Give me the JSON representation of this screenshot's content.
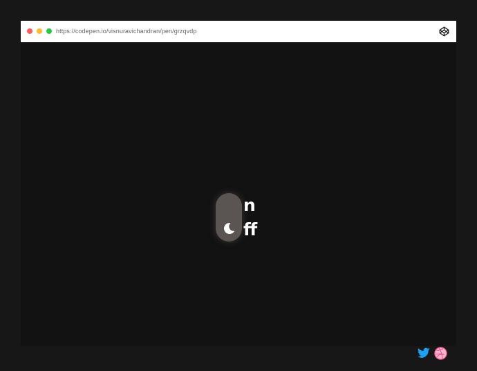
{
  "browser": {
    "url": "https://codepen.io/visnuravichandran/pen/grzqvdp",
    "controls": {
      "close_color": "#ff5f57",
      "minimize_color": "#febc2e",
      "maximize_color": "#28c840"
    },
    "logo_icon": "codepen-icon"
  },
  "demo": {
    "toggle_state": "off",
    "toggle_icon": "moon-icon",
    "text_on_visible": "n",
    "text_off_visible": "ff",
    "toggle_color": "#5a5552",
    "background_color": "#121212"
  },
  "social": {
    "twitter_icon": "twitter-icon",
    "twitter_color": "#1da1f2",
    "dribbble_icon": "dribbble-icon",
    "dribbble_color": "#ea4c89"
  }
}
